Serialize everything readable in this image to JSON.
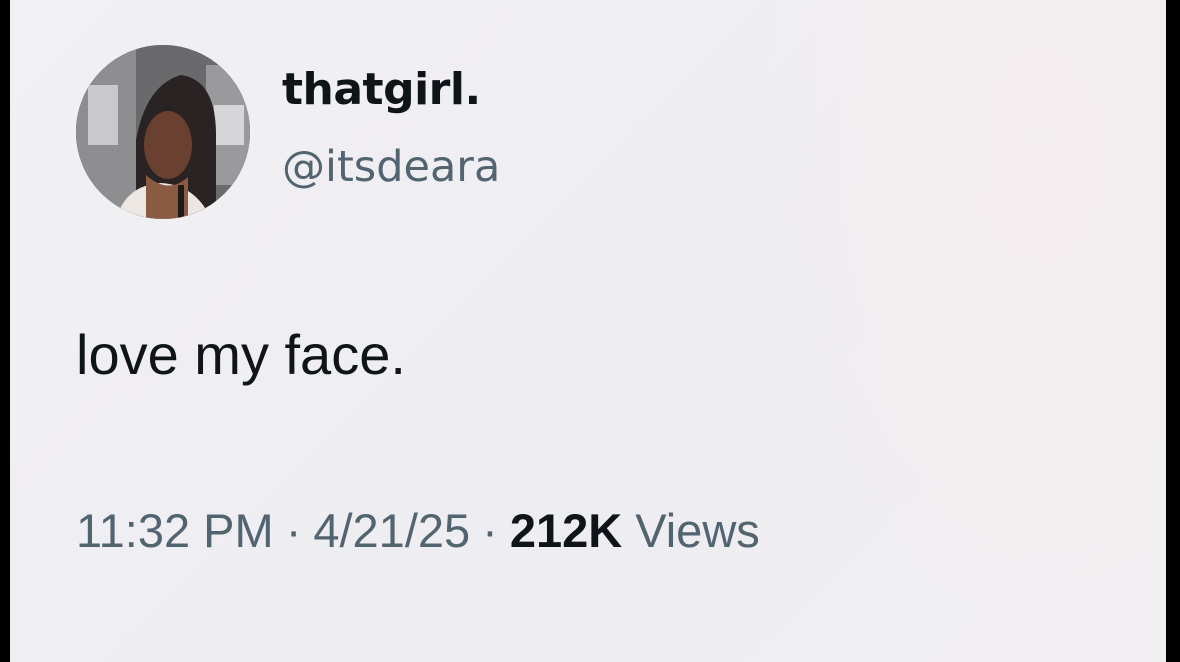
{
  "author": {
    "display_name": "thatgirl.",
    "handle": "@itsdeara",
    "avatar_icon": "profile-photo"
  },
  "tweet": {
    "text": "love my face."
  },
  "meta": {
    "time": "11:32 PM",
    "separator": "·",
    "date": "4/21/25",
    "views_count": "212K",
    "views_label": "Views"
  },
  "colors": {
    "background": "#efeef2",
    "primary_text": "#0f1419",
    "secondary_text": "#536471"
  }
}
